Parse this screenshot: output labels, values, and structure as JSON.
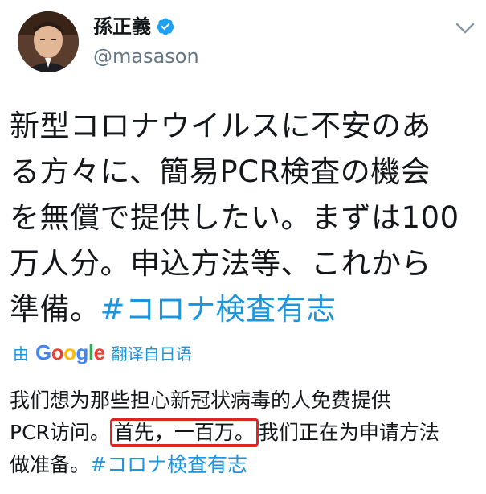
{
  "tweet": {
    "display_name": "孫正義",
    "handle": "@masason",
    "text_lines": [
      "新型コロナウイルスに不安のあ",
      "る方々に、簡易PCR検査の機会",
      "を無償で提供したい。まずは100",
      "万人分。申込方法等、これから",
      "準備。"
    ],
    "hashtag": "#コロナ検査有志"
  },
  "translation": {
    "by_label": "由",
    "provider_letters": [
      {
        "ch": "G",
        "color": "#4285F4"
      },
      {
        "ch": "o",
        "color": "#EA4335"
      },
      {
        "ch": "o",
        "color": "#FBBC05"
      },
      {
        "ch": "g",
        "color": "#4285F4"
      },
      {
        "ch": "l",
        "color": "#34A853"
      },
      {
        "ch": "e",
        "color": "#EA4335"
      }
    ],
    "action_label": "翻译自日语",
    "line1": "我们想为那些担心新冠状病毒的人免费提供",
    "line2_pre": "PCR访问。",
    "line2_highlight": "首先，一百万。",
    "line2_post": "我们正在为申请方法",
    "line3": "做准备。",
    "hashtag": "#コロナ検査有志"
  },
  "colors": {
    "hashtag": "#1b95e0",
    "highlight_border": "#e02424",
    "verified": "#1da1f2"
  }
}
